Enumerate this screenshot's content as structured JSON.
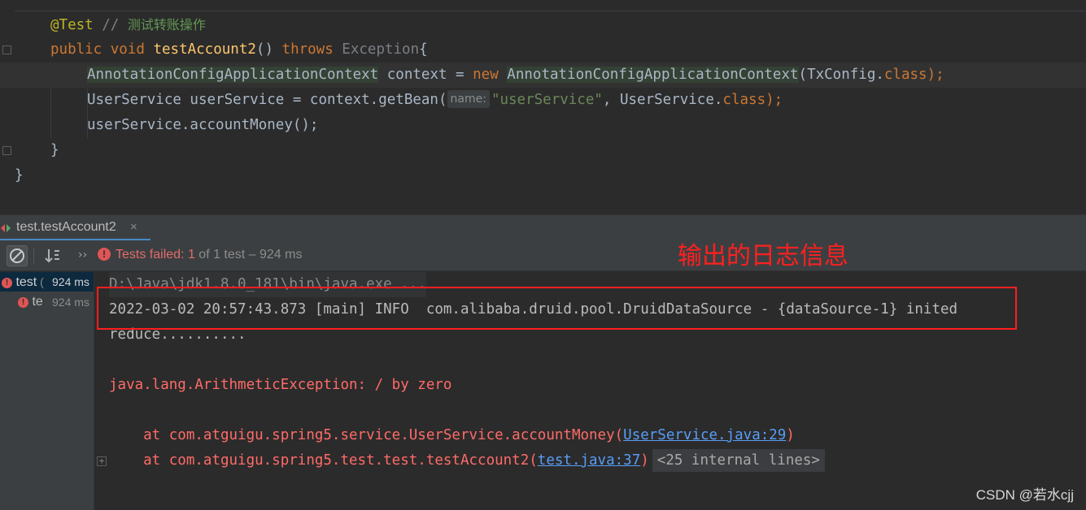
{
  "editor": {
    "lines": {
      "l1": {
        "annotation": "@Test",
        "comment_slashes": " // ",
        "comment_text": "测试转账操作"
      },
      "l2": {
        "public": "public",
        "void": "void",
        "method": "testAccount2",
        "parens": "()",
        "throws": "throws",
        "exception": "Exception",
        "brace": "{"
      },
      "l3": {
        "type": "AnnotationConfigApplicationContext",
        "rest": " context = ",
        "new": "new",
        "ctor": "AnnotationConfigApplicationContext",
        "arg": "(TxConfig.",
        "class_kw": "class",
        "end": ");"
      },
      "l4": {
        "text": "UserService userService = context.getBean(",
        "hint": "name:",
        "string": "\"userService\"",
        "mid": ", UserService.",
        "class_kw": "class",
        "end": ");"
      },
      "l5": {
        "text": "userService.accountMoney();"
      },
      "l6": {
        "text": "}"
      },
      "l7": {
        "text": "}"
      }
    }
  },
  "run_panel": {
    "tab_label": "test.testAccount2",
    "tab_close": "×",
    "status": {
      "failed_label": "Tests failed:",
      "count": "1",
      "of_text": "of 1 test – 924 ms"
    },
    "chevron": "››",
    "tree": [
      {
        "name": "test",
        "suffix": " (",
        "time": "924 ms"
      },
      {
        "name": "te",
        "time": "924 ms"
      }
    ],
    "console": {
      "cmd": "D:\\Java\\jdk1.8.0_181\\bin\\java.exe ...",
      "log": "2022-03-02 20:57:43.873 [main] INFO  com.alibaba.druid.pool.DruidDataSource - {dataSource-1} inited",
      "reduce": "reduce..........",
      "exception": "java.lang.ArithmeticException: / by zero",
      "trace1_prefix": "    at com.atguigu.spring5.service.UserService.accountMoney(",
      "trace1_link": "UserService.java:29",
      "trace1_suffix": ")",
      "trace2_prefix": "    at com.atguigu.spring5.test.test.testAccount2(",
      "trace2_link": "test.java:37",
      "trace2_suffix": ")",
      "internal_lines": "<25 internal lines>"
    }
  },
  "overlay": {
    "annotation_text": "输出的日志信息",
    "highlight_color": "#ff1f1f"
  },
  "watermark": "CSDN @若水cjj"
}
